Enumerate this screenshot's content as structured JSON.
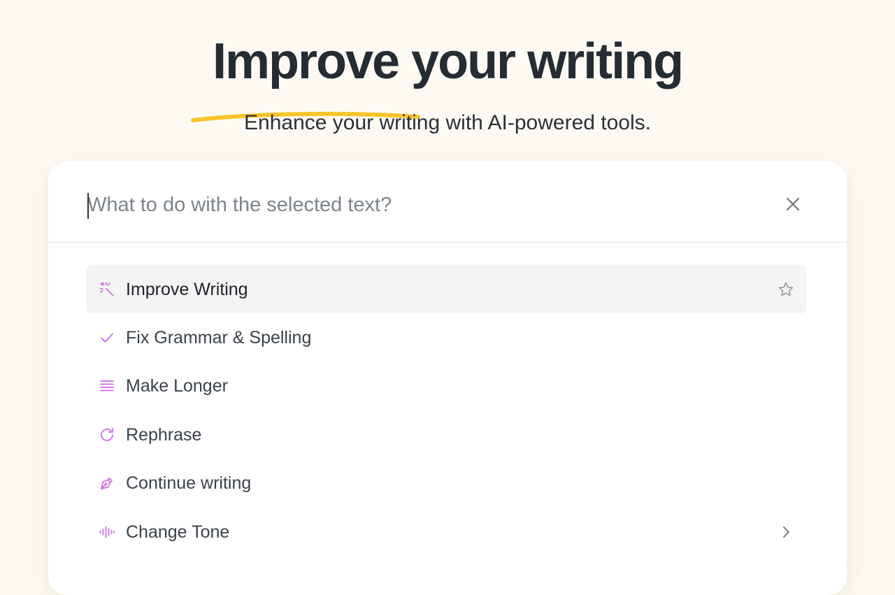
{
  "hero": {
    "title": "Improve your writing",
    "subtitle": "Enhance your writing with AI-powered tools.",
    "underline_color": "#f7c52b"
  },
  "command_panel": {
    "search_placeholder": "What to do with the selected text?",
    "search_value": "",
    "close_icon": "close-icon",
    "accent_color": "#cc6ee0",
    "items": [
      {
        "label": "Improve Writing",
        "icon": "magic-wand-icon",
        "right_icon": "star-icon",
        "active": true
      },
      {
        "label": "Fix Grammar & Spelling",
        "icon": "checkmark-icon"
      },
      {
        "label": "Make Longer",
        "icon": "text-lines-icon"
      },
      {
        "label": "Rephrase",
        "icon": "refresh-icon"
      },
      {
        "label": "Continue writing",
        "icon": "pen-nib-icon"
      },
      {
        "label": "Change Tone",
        "icon": "audio-wave-icon",
        "right_icon": "chevron-right-icon"
      }
    ]
  }
}
